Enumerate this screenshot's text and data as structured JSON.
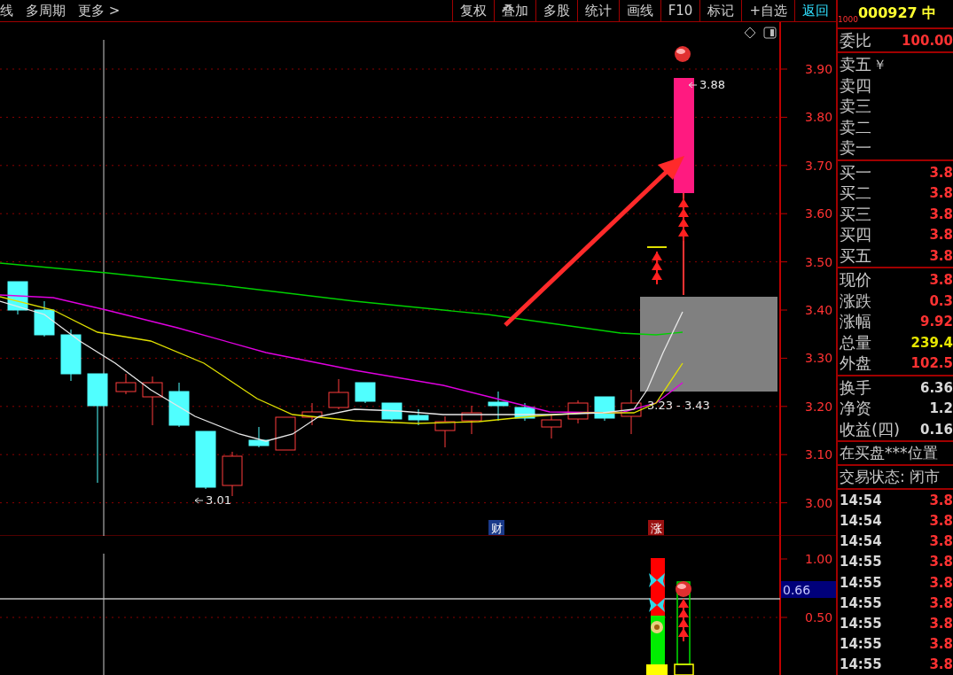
{
  "toolbar": {
    "left": [
      "线",
      "多周期",
      "更多 >"
    ],
    "buttons": [
      {
        "label": "复权",
        "kind": "normal"
      },
      {
        "label": "叠加",
        "kind": "normal"
      },
      {
        "label": "多股",
        "kind": "normal"
      },
      {
        "label": "统计",
        "kind": "normal"
      },
      {
        "label": "画线",
        "kind": "normal"
      },
      {
        "label": "F10",
        "kind": "normal"
      },
      {
        "label": "标记",
        "kind": "normal"
      },
      {
        "label": "+自选",
        "kind": "normal"
      },
      {
        "label": "返回",
        "kind": "back"
      }
    ]
  },
  "chart": {
    "price_labels": [
      "3.90",
      "3.80",
      "3.70",
      "3.60",
      "3.50",
      "3.40",
      "3.30",
      "3.20",
      "3.10",
      "3.00"
    ],
    "markers": [
      {
        "text": "3.88",
        "kind": "high"
      },
      {
        "text": "3.01",
        "kind": "low"
      },
      {
        "text": "3.23 - 3.43",
        "kind": "range"
      }
    ],
    "badges": [
      {
        "text": "财",
        "kind": "finance"
      },
      {
        "text": "涨",
        "kind": "limit"
      }
    ]
  },
  "indicator": {
    "axis_labels": [
      "1.00",
      "0.50"
    ],
    "cursor_value": "0.66"
  },
  "quote": {
    "unit": "1000",
    "code": "000927",
    "name": "中",
    "ratio": {
      "label": "委比",
      "value": "100.00",
      "color": "#ff3232"
    },
    "sells": [
      {
        "label": "卖五",
        "extra": "￥"
      },
      {
        "label": "卖四"
      },
      {
        "label": "卖三"
      },
      {
        "label": "卖二"
      },
      {
        "label": "卖一"
      }
    ],
    "buys": [
      {
        "label": "买一",
        "value": "3.8"
      },
      {
        "label": "买二",
        "value": "3.8"
      },
      {
        "label": "买三",
        "value": "3.8"
      },
      {
        "label": "买四",
        "value": "3.8"
      },
      {
        "label": "买五",
        "value": "3.8"
      }
    ],
    "stats": [
      {
        "label": "现价",
        "value": "3.8",
        "color": "#ff3232"
      },
      {
        "label": "涨跌",
        "value": "0.3",
        "color": "#ff3232"
      },
      {
        "label": "涨幅",
        "value": "9.92",
        "color": "#ff3232"
      },
      {
        "label": "总量",
        "value": "239.4",
        "color": "#e6e600"
      },
      {
        "label": "外盘",
        "value": "102.5",
        "color": "#ff3232"
      }
    ],
    "fundamentals": [
      {
        "label": "换手",
        "value": "6.36"
      },
      {
        "label": "净资",
        "value": "1.2"
      },
      {
        "label": "收益(四)",
        "value": "0.16"
      }
    ],
    "notice": "在买盘***位置",
    "status": "交易状态: 闭市",
    "ticks": [
      {
        "time": "14:54",
        "price": "3.8"
      },
      {
        "time": "14:54",
        "price": "3.8"
      },
      {
        "time": "14:54",
        "price": "3.8"
      },
      {
        "time": "14:55",
        "price": "3.8"
      },
      {
        "time": "14:55",
        "price": "3.8"
      },
      {
        "time": "14:55",
        "price": "3.8"
      },
      {
        "time": "14:55",
        "price": "3.8"
      },
      {
        "time": "14:55",
        "price": "3.8"
      },
      {
        "time": "14:55",
        "price": "3.8"
      }
    ]
  }
}
